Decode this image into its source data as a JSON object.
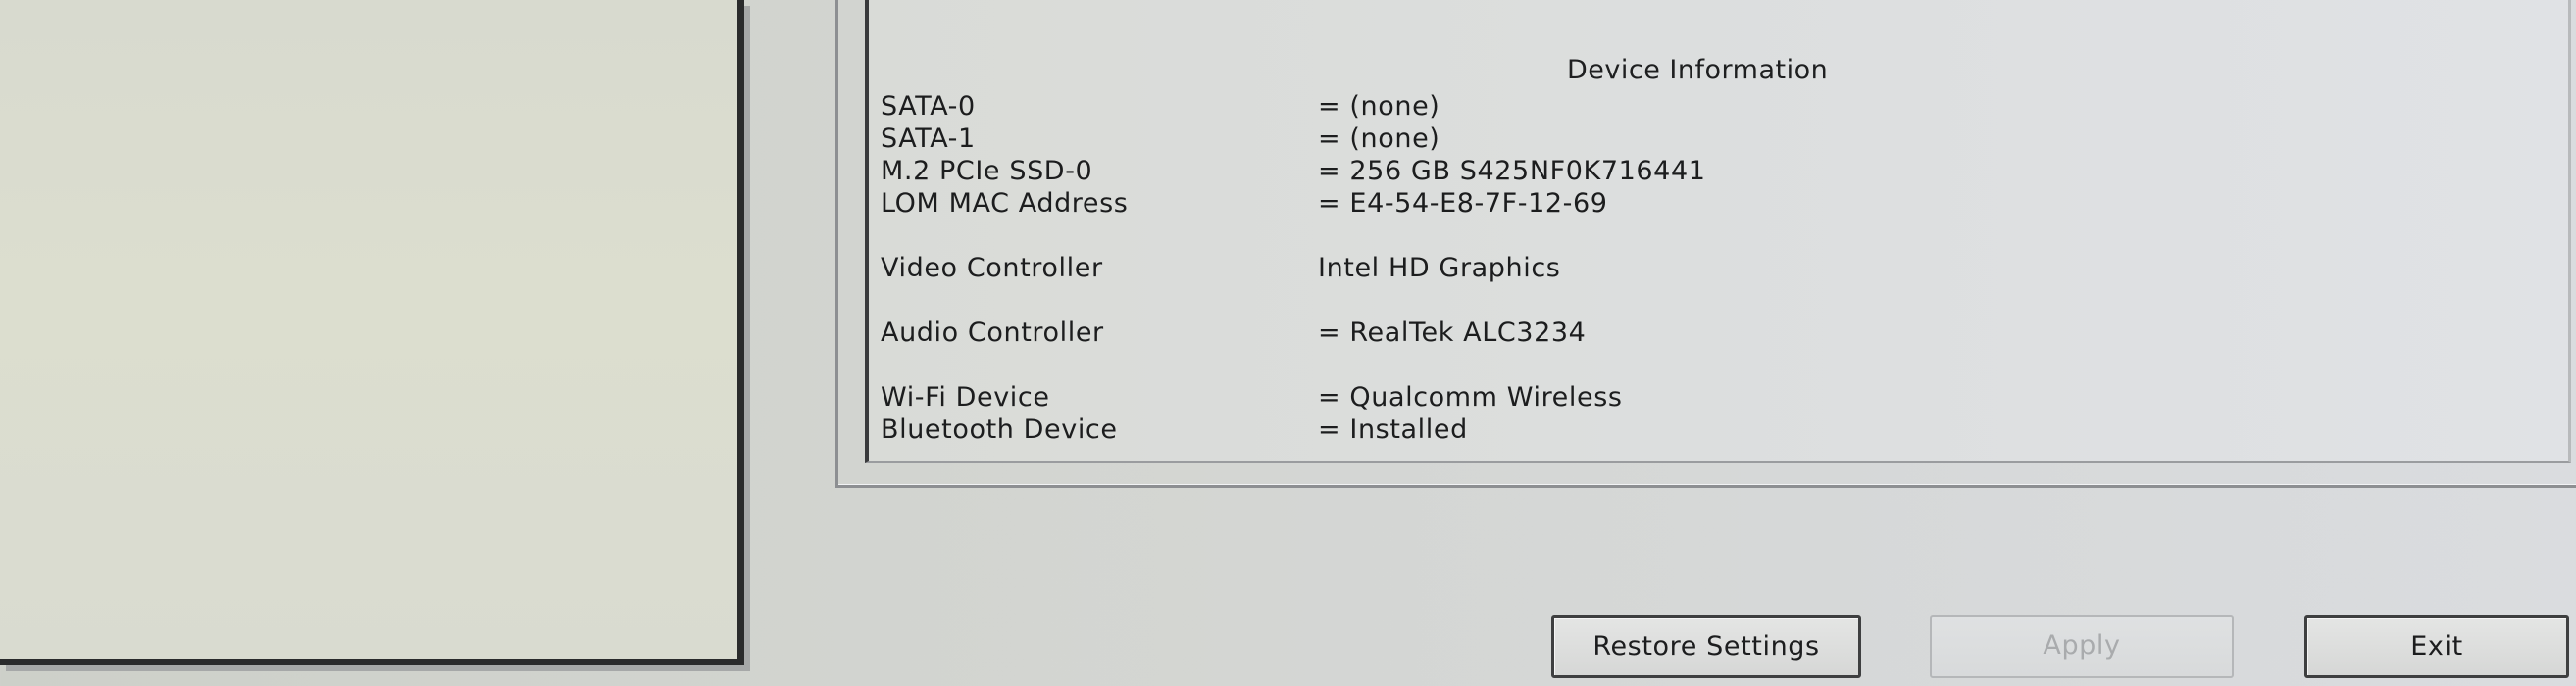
{
  "device_info": {
    "title": "Device Information",
    "rows": [
      {
        "label": "SATA-0",
        "value": "= (none)"
      },
      {
        "label": "SATA-1",
        "value": "= (none)"
      },
      {
        "label": "M.2 PCIe SSD-0",
        "value": "= 256 GB S425NF0K716441"
      },
      {
        "label": "LOM MAC Address",
        "value": "= E4-54-E8-7F-12-69"
      },
      {
        "label": "Video Controller",
        "value": "Intel HD Graphics"
      },
      {
        "label": "Audio Controller",
        "value": "= RealTek ALC3234"
      },
      {
        "label": "Wi-Fi Device",
        "value": "= Qualcomm Wireless"
      },
      {
        "label": "Bluetooth Device",
        "value": "= Installed"
      }
    ]
  },
  "buttons": {
    "restore": {
      "label": "Restore Settings",
      "enabled": true
    },
    "apply": {
      "label": "Apply",
      "enabled": false
    },
    "exit": {
      "label": "Exit",
      "enabled": true
    }
  }
}
